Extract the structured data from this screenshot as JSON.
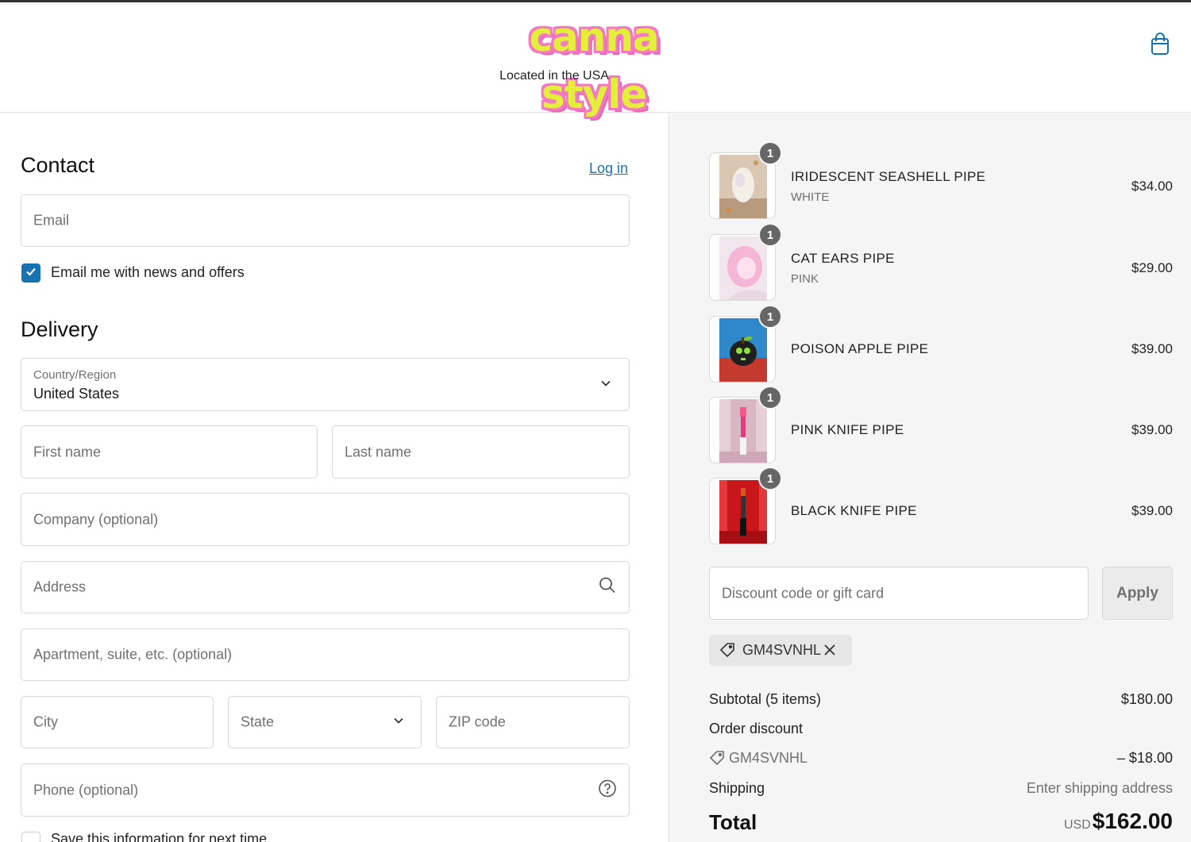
{
  "brand": {
    "logo_text": "canna style",
    "tagline": "Located in the USA",
    "colors": {
      "logo_fill": "#e4ef3a",
      "logo_outline": "#f27ac2",
      "accent": "#1773b0"
    }
  },
  "header": {
    "cart_icon": "shopping-bag-icon"
  },
  "contact": {
    "heading": "Contact",
    "login_link": "Log in",
    "email_placeholder": "Email",
    "newsletter_label": "Email me with news and offers",
    "newsletter_checked": true
  },
  "delivery": {
    "heading": "Delivery",
    "country_label": "Country/Region",
    "country_value": "United States",
    "first_name_placeholder": "First name",
    "last_name_placeholder": "Last name",
    "company_placeholder": "Company (optional)",
    "address_placeholder": "Address",
    "apartment_placeholder": "Apartment, suite, etc. (optional)",
    "city_placeholder": "City",
    "state_placeholder": "State",
    "zip_placeholder": "ZIP code",
    "phone_placeholder": "Phone (optional)",
    "save_info_label": "Save this information for next time"
  },
  "cart": {
    "items": [
      {
        "name": "IRIDESCENT SEASHELL PIPE",
        "variant": "WHITE",
        "price": "$34.00",
        "qty": "1"
      },
      {
        "name": "CAT EARS PIPE",
        "variant": "PINK",
        "price": "$29.00",
        "qty": "1"
      },
      {
        "name": "POISON APPLE PIPE",
        "variant": "",
        "price": "$39.00",
        "qty": "1"
      },
      {
        "name": "PINK KNIFE PIPE",
        "variant": "",
        "price": "$39.00",
        "qty": "1"
      },
      {
        "name": "BLACK KNIFE PIPE",
        "variant": "",
        "price": "$39.00",
        "qty": "1"
      }
    ],
    "discount_placeholder": "Discount code or gift card",
    "apply_label": "Apply",
    "applied_code": "GM4SVNHL"
  },
  "summary": {
    "subtotal_label": "Subtotal (5 items)",
    "subtotal_value": "$180.00",
    "order_discount_label": "Order discount",
    "discount_code": "GM4SVNHL",
    "discount_value": "– $18.00",
    "shipping_label": "Shipping",
    "shipping_value": "Enter shipping address",
    "total_label": "Total",
    "currency": "USD",
    "total_value": "$162.00"
  }
}
